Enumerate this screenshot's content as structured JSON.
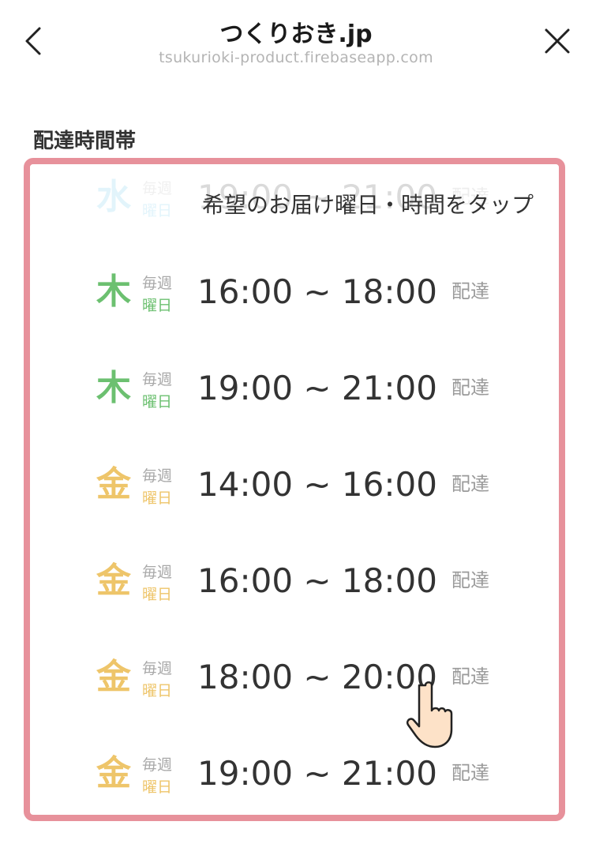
{
  "header": {
    "title": "つくりおき.jp",
    "url": "tsukurioki-product.firebaseapp.com"
  },
  "section": {
    "label": "配達時間帯"
  },
  "hint": "希望のお届け曜日・時間をタップ",
  "slots": [
    {
      "day": "水",
      "weekly": "毎週",
      "yobi": "曜日",
      "time": "19:00 ~ 21:00",
      "delivery": "配達",
      "color": "#5ec4e8"
    },
    {
      "day": "木",
      "weekly": "毎週",
      "yobi": "曜日",
      "time": "16:00 ~ 18:00",
      "delivery": "配達",
      "color": "#6cc070"
    },
    {
      "day": "木",
      "weekly": "毎週",
      "yobi": "曜日",
      "time": "19:00 ~ 21:00",
      "delivery": "配達",
      "color": "#6cc070"
    },
    {
      "day": "金",
      "weekly": "毎週",
      "yobi": "曜日",
      "time": "14:00 ~ 16:00",
      "delivery": "配達",
      "color": "#eec56a"
    },
    {
      "day": "金",
      "weekly": "毎週",
      "yobi": "曜日",
      "time": "16:00 ~ 18:00",
      "delivery": "配達",
      "color": "#eec56a"
    },
    {
      "day": "金",
      "weekly": "毎週",
      "yobi": "曜日",
      "time": "18:00 ~ 20:00",
      "delivery": "配達",
      "color": "#eec56a"
    },
    {
      "day": "金",
      "weekly": "毎週",
      "yobi": "曜日",
      "time": "19:00 ~ 21:00",
      "delivery": "配達",
      "color": "#eec56a"
    }
  ],
  "colors": {
    "frame": "#e7919b"
  },
  "icons": {
    "back": "chevron-left-icon",
    "close": "close-icon",
    "pointer": "hand-pointer-icon"
  }
}
